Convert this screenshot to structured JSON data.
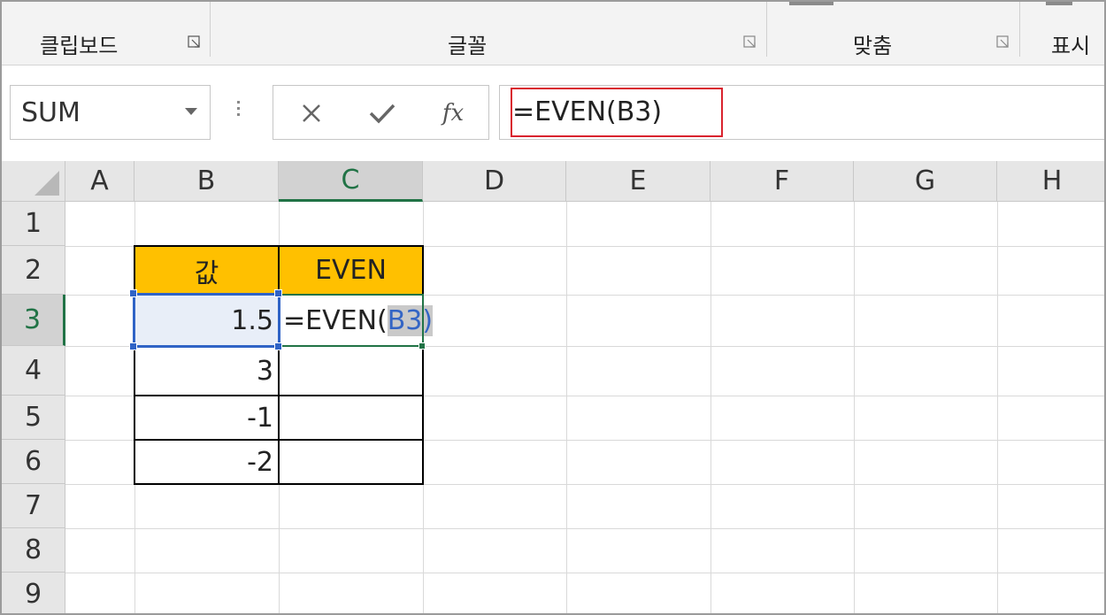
{
  "ribbon": {
    "groups": [
      {
        "label": "클립보드"
      },
      {
        "label": "글꼴"
      },
      {
        "label": "맞춤"
      },
      {
        "label": "표시"
      }
    ]
  },
  "formula_bar": {
    "name_box": "SUM",
    "cancel_icon": "close-icon",
    "enter_icon": "check-icon",
    "fx_label": "fx",
    "formula": "=EVEN(B3)"
  },
  "sheet": {
    "columns": [
      "A",
      "B",
      "C",
      "D",
      "E",
      "F",
      "G",
      "H"
    ],
    "rows": [
      "1",
      "2",
      "3",
      "4",
      "5",
      "6",
      "7",
      "8",
      "9"
    ],
    "active_column": "C",
    "active_row": "3",
    "cells": {
      "B2": "값",
      "C2": "EVEN",
      "B3": "1.5",
      "C3_prefix": "=EVEN(",
      "C3_ref": "B3",
      "C3_suffix": ")",
      "B4": "3",
      "B5": "-1",
      "B6": "-2"
    }
  },
  "colors": {
    "header_fill": "#ffc000",
    "accent_green": "#217346",
    "reference_blue": "#2f63c6",
    "highlight_red": "#d9232e"
  }
}
